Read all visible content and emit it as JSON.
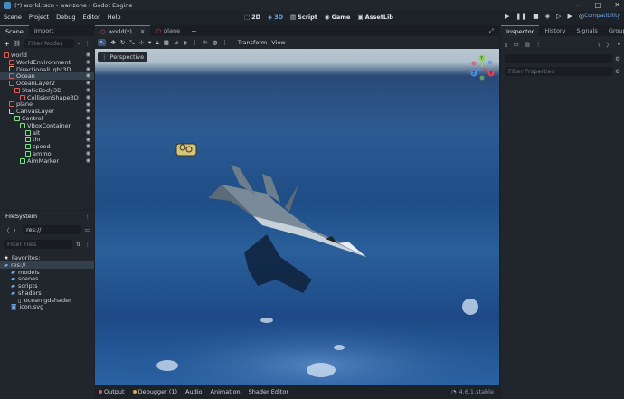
{
  "window": {
    "title": "(*) world.tscn - war-zone - Godot Engine",
    "controls": [
      "—",
      "□",
      "✕"
    ]
  },
  "menu": [
    "Scene",
    "Project",
    "Debug",
    "Editor",
    "Help"
  ],
  "workspaces": [
    {
      "label": "2D",
      "icon": "2d-icon"
    },
    {
      "label": "3D",
      "icon": "3d-icon",
      "active": true
    },
    {
      "label": "Script",
      "icon": "script-icon"
    },
    {
      "label": "Game",
      "icon": "game-icon"
    },
    {
      "label": "AssetLib",
      "icon": "assetlib-icon"
    }
  ],
  "renderer": "Compatibility",
  "scene_dock": {
    "tabs": [
      "Scene",
      "Import"
    ],
    "filter_placeholder": "Filter Nodes",
    "nodes": [
      {
        "label": "world",
        "depth": 0,
        "color": "#e05b5b"
      },
      {
        "label": "WorldEnvironment",
        "depth": 1,
        "color": "#e05b5b"
      },
      {
        "label": "DirectionalLight3D",
        "depth": 1,
        "color": "#e8a44c"
      },
      {
        "label": "Ocean",
        "depth": 1,
        "color": "#e05b5b",
        "selected": true
      },
      {
        "label": "OceanLayer2",
        "depth": 1,
        "color": "#e05b5b"
      },
      {
        "label": "StaticBody3D",
        "depth": 2,
        "color": "#e05b5b"
      },
      {
        "label": "CollisionShape3D",
        "depth": 3,
        "color": "#e05b5b"
      },
      {
        "label": "plane",
        "depth": 1,
        "color": "#e05b5b"
      },
      {
        "label": "CanvasLayer",
        "depth": 1,
        "color": "#cdd2d9"
      },
      {
        "label": "Control",
        "depth": 2,
        "color": "#7de38b"
      },
      {
        "label": "VBoxContainer",
        "depth": 3,
        "color": "#7de38b"
      },
      {
        "label": "alt",
        "depth": 4,
        "color": "#7de38b"
      },
      {
        "label": "thr",
        "depth": 4,
        "color": "#7de38b"
      },
      {
        "label": "speed",
        "depth": 4,
        "color": "#7de38b"
      },
      {
        "label": "ammo",
        "depth": 4,
        "color": "#7de38b"
      },
      {
        "label": "AimMarker",
        "depth": 3,
        "color": "#7de38b"
      }
    ]
  },
  "filesystem": {
    "title": "FileSystem",
    "path": "res://",
    "filter_placeholder": "Filter Files",
    "items": [
      {
        "label": "Favorites:",
        "depth": 0,
        "icon": "star-icon"
      },
      {
        "label": "res://",
        "depth": 0,
        "icon": "folder-icon",
        "selected": true
      },
      {
        "label": "models",
        "depth": 1,
        "icon": "folder-icon"
      },
      {
        "label": "scenes",
        "depth": 1,
        "icon": "folder-icon"
      },
      {
        "label": "scripts",
        "depth": 1,
        "icon": "folder-icon"
      },
      {
        "label": "shaders",
        "depth": 1,
        "icon": "folder-icon"
      },
      {
        "label": "ocean.gdshader",
        "depth": 2,
        "icon": "file-icon"
      },
      {
        "label": "icon.svg",
        "depth": 1,
        "icon": "image-icon"
      }
    ]
  },
  "editor_tabs": [
    {
      "label": "world(*)",
      "active": true
    },
    {
      "label": "plane"
    }
  ],
  "viewport_toolbar": {
    "transform": "Transform",
    "view": "View",
    "perspective": "Perspective"
  },
  "gizmo": {
    "x": "X",
    "y": "Y",
    "z": "Z"
  },
  "inspector": {
    "tabs": [
      "Inspector",
      "History",
      "Signals",
      "Groups"
    ],
    "filter_placeholder": "Filter Properties"
  },
  "bottom_panel": {
    "tabs": [
      "Output",
      "Debugger (1)",
      "Audio",
      "Animation",
      "Shader Editor"
    ],
    "version": "4.6.1.stable"
  }
}
